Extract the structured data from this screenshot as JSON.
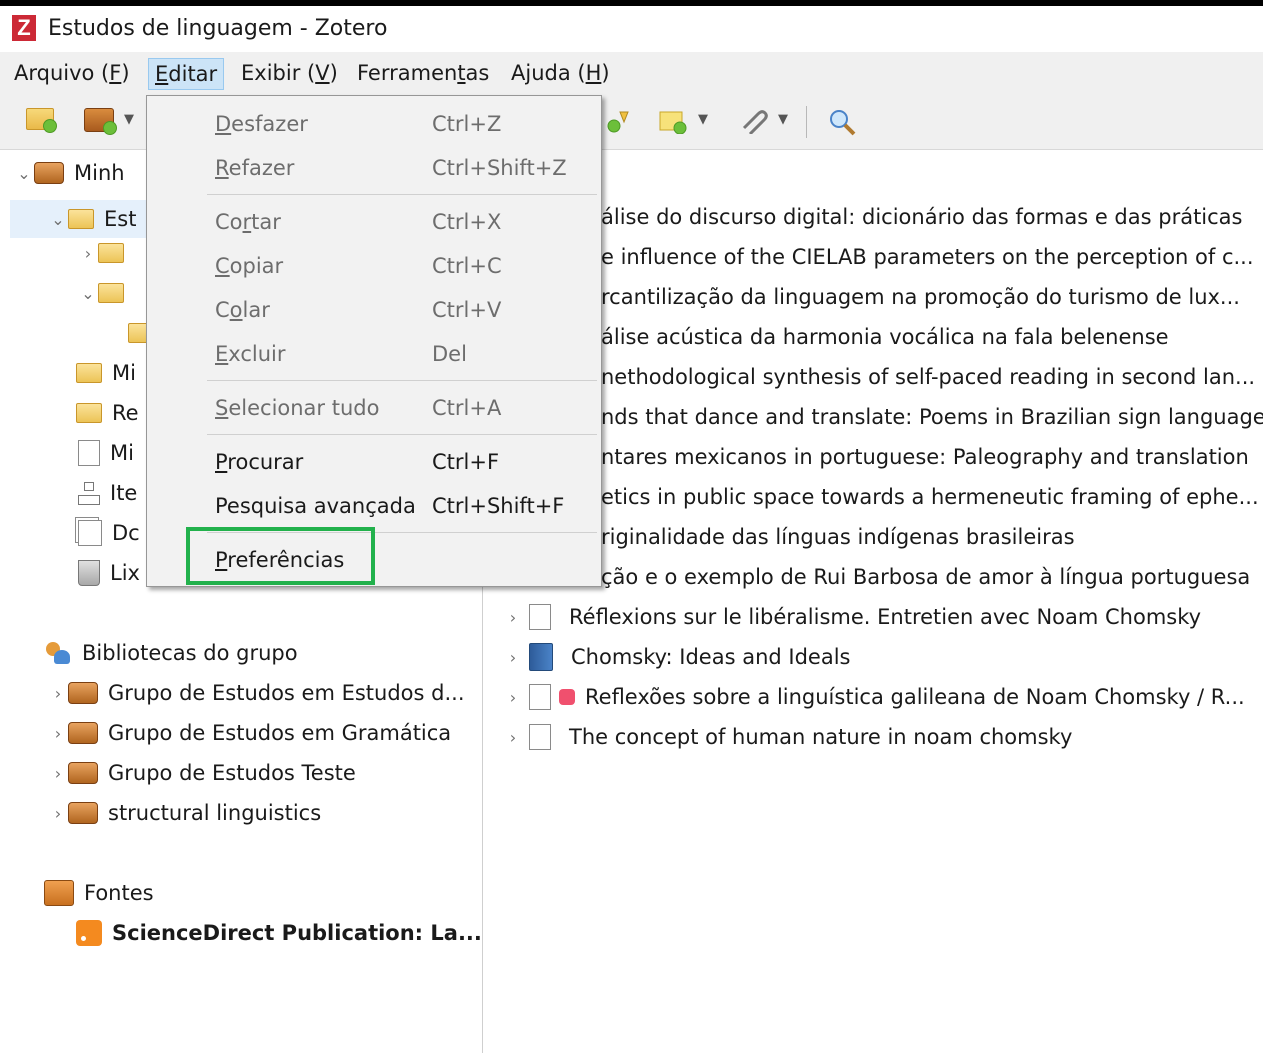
{
  "window": {
    "title": "Estudos de linguagem - Zotero",
    "logo_letter": "Z"
  },
  "menubar": [
    {
      "pre": "Arquivo (",
      "u": "F",
      "post": ")"
    },
    {
      "pre": "",
      "u": "E",
      "post": "ditar"
    },
    {
      "pre": "Exibir (",
      "u": "V",
      "post": ")"
    },
    {
      "pre": "Ferramen",
      "u": "t",
      "post": "as"
    },
    {
      "pre": "Ajuda (",
      "u": "H",
      "post": ")"
    }
  ],
  "edit_menu": {
    "items": [
      {
        "pre": "",
        "u": "D",
        "post": "esfazer",
        "shortcut": "Ctrl+Z",
        "disabled": true
      },
      {
        "pre": "",
        "u": "R",
        "post": "efazer",
        "shortcut": "Ctrl+Shift+Z",
        "disabled": true
      },
      {
        "pre": "Co",
        "u": "r",
        "post": "tar",
        "shortcut": "Ctrl+X",
        "disabled": true
      },
      {
        "pre": "",
        "u": "C",
        "post": "opiar",
        "shortcut": "Ctrl+C",
        "disabled": true
      },
      {
        "pre": "C",
        "u": "o",
        "post": "lar",
        "shortcut": "Ctrl+V",
        "disabled": true
      },
      {
        "pre": "",
        "u": "E",
        "post": "xcluir",
        "shortcut": "Del",
        "disabled": true
      },
      {
        "pre": "",
        "u": "S",
        "post": "elecionar tudo",
        "shortcut": "Ctrl+A",
        "disabled": true
      },
      {
        "pre": "",
        "u": "P",
        "post": "rocurar",
        "shortcut": "Ctrl+F",
        "disabled": false
      },
      {
        "pre": "Pesquisa avançada",
        "u": "",
        "post": "",
        "shortcut": "Ctrl+Shift+F",
        "disabled": false
      },
      {
        "pre": "",
        "u": "P",
        "post": "referências",
        "shortcut": "",
        "disabled": false
      }
    ]
  },
  "collections_tree": {
    "my_library_label": "Minh",
    "selected_collection": "Est",
    "partial_items": [
      "Mi",
      "Re",
      "Mi",
      "Ite",
      "Dc",
      "Lix"
    ],
    "group_libraries_label": "Bibliotecas do grupo",
    "groups": [
      "Grupo de Estudos em Estudos d...",
      "Grupo de Estudos em Gramática",
      "Grupo de Estudos Teste",
      "structural linguistics"
    ],
    "feeds_label": "Fontes",
    "feeds": [
      "ScienceDirect Publication: La..."
    ]
  },
  "items": [
    {
      "title": "álise do discurso digital: dicionário das formas e das práticas",
      "type": "partial"
    },
    {
      "title": "e influence of the CIELAB parameters on the perception of c...",
      "type": "partial"
    },
    {
      "title": "rcantilização da linguagem na promoção do turismo de lux...",
      "type": "partial"
    },
    {
      "title": "álise acústica da harmonia vocálica na fala belenense",
      "type": "partial"
    },
    {
      "title": "nethodological synthesis of self-paced reading in second lan...",
      "type": "partial"
    },
    {
      "title": "nds that dance and translate: Poems in Brazilian sign language",
      "type": "partial"
    },
    {
      "title": "ntares mexicanos in portuguese: Paleography and translation",
      "type": "partial"
    },
    {
      "title": "etics in public space towards a hermeneutic framing of ephe...",
      "type": "partial"
    },
    {
      "title": "riginalidade das línguas indígenas brasileiras",
      "type": "partial"
    },
    {
      "title": "ção e o exemplo de Rui Barbosa de amor à língua portuguesa",
      "type": "partial"
    },
    {
      "title": "Réflexions sur le libéralisme. Entretien avec Noam Chomsky",
      "type": "document"
    },
    {
      "title": "Chomsky: Ideas and Ideals",
      "type": "book"
    },
    {
      "title": "Reflexões sobre a linguística galileana de Noam Chomsky / R...",
      "type": "document-tagged"
    },
    {
      "title": "The concept of human nature in noam chomsky",
      "type": "document"
    }
  ]
}
